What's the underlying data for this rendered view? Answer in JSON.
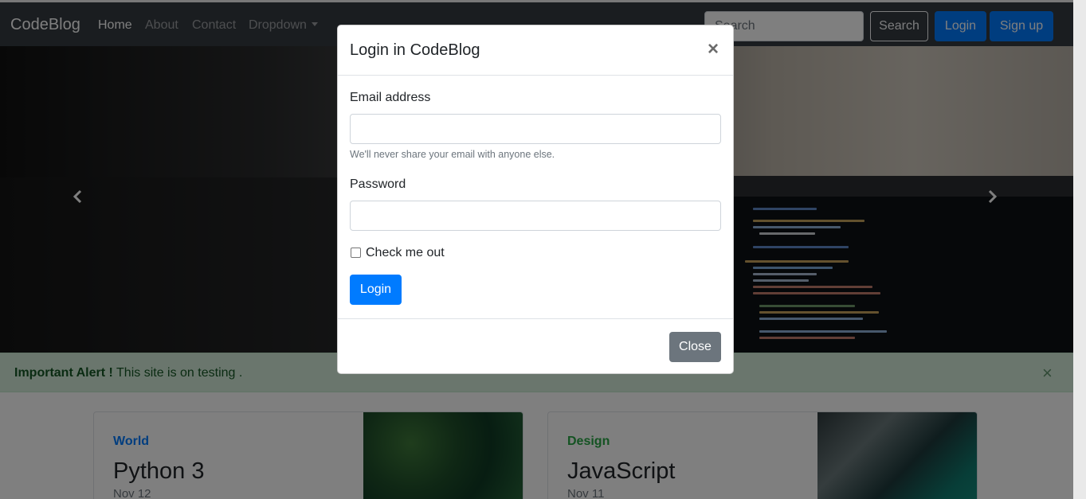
{
  "navbar": {
    "brand": "CodeBlog",
    "links": [
      {
        "label": "Home",
        "active": true
      },
      {
        "label": "About",
        "active": false
      },
      {
        "label": "Contact",
        "active": false
      },
      {
        "label": "Dropdown",
        "active": false
      }
    ],
    "search_placeholder": "Search",
    "search_button": "Search",
    "login_button": "Login",
    "signup_button": "Sign up"
  },
  "carousel": {
    "prev_icon": "chevron-left-icon",
    "next_icon": "chevron-right-icon"
  },
  "alert": {
    "strong": "Important Alert !",
    "text": "This site is on testing .",
    "close": "×"
  },
  "cards": [
    {
      "category": "World",
      "category_color": "#007bff",
      "title": "Python 3",
      "date": "Nov 12"
    },
    {
      "category": "Design",
      "category_color": "#28a745",
      "title": "JavaScript",
      "date": "Nov 11"
    }
  ],
  "modal": {
    "title": "Login in CodeBlog",
    "close_x": "×",
    "email_label": "Email address",
    "email_value": "",
    "email_help": "We'll never share your email with anyone else.",
    "password_label": "Password",
    "password_value": "",
    "checkbox_label": "Check me out",
    "checkbox_checked": false,
    "submit_label": "Login",
    "close_label": "Close"
  },
  "colors": {
    "navbar_bg": "#343a40",
    "primary": "#007bff",
    "secondary": "#6c757d",
    "alert_bg": "#d4edda",
    "alert_text": "#155724"
  }
}
